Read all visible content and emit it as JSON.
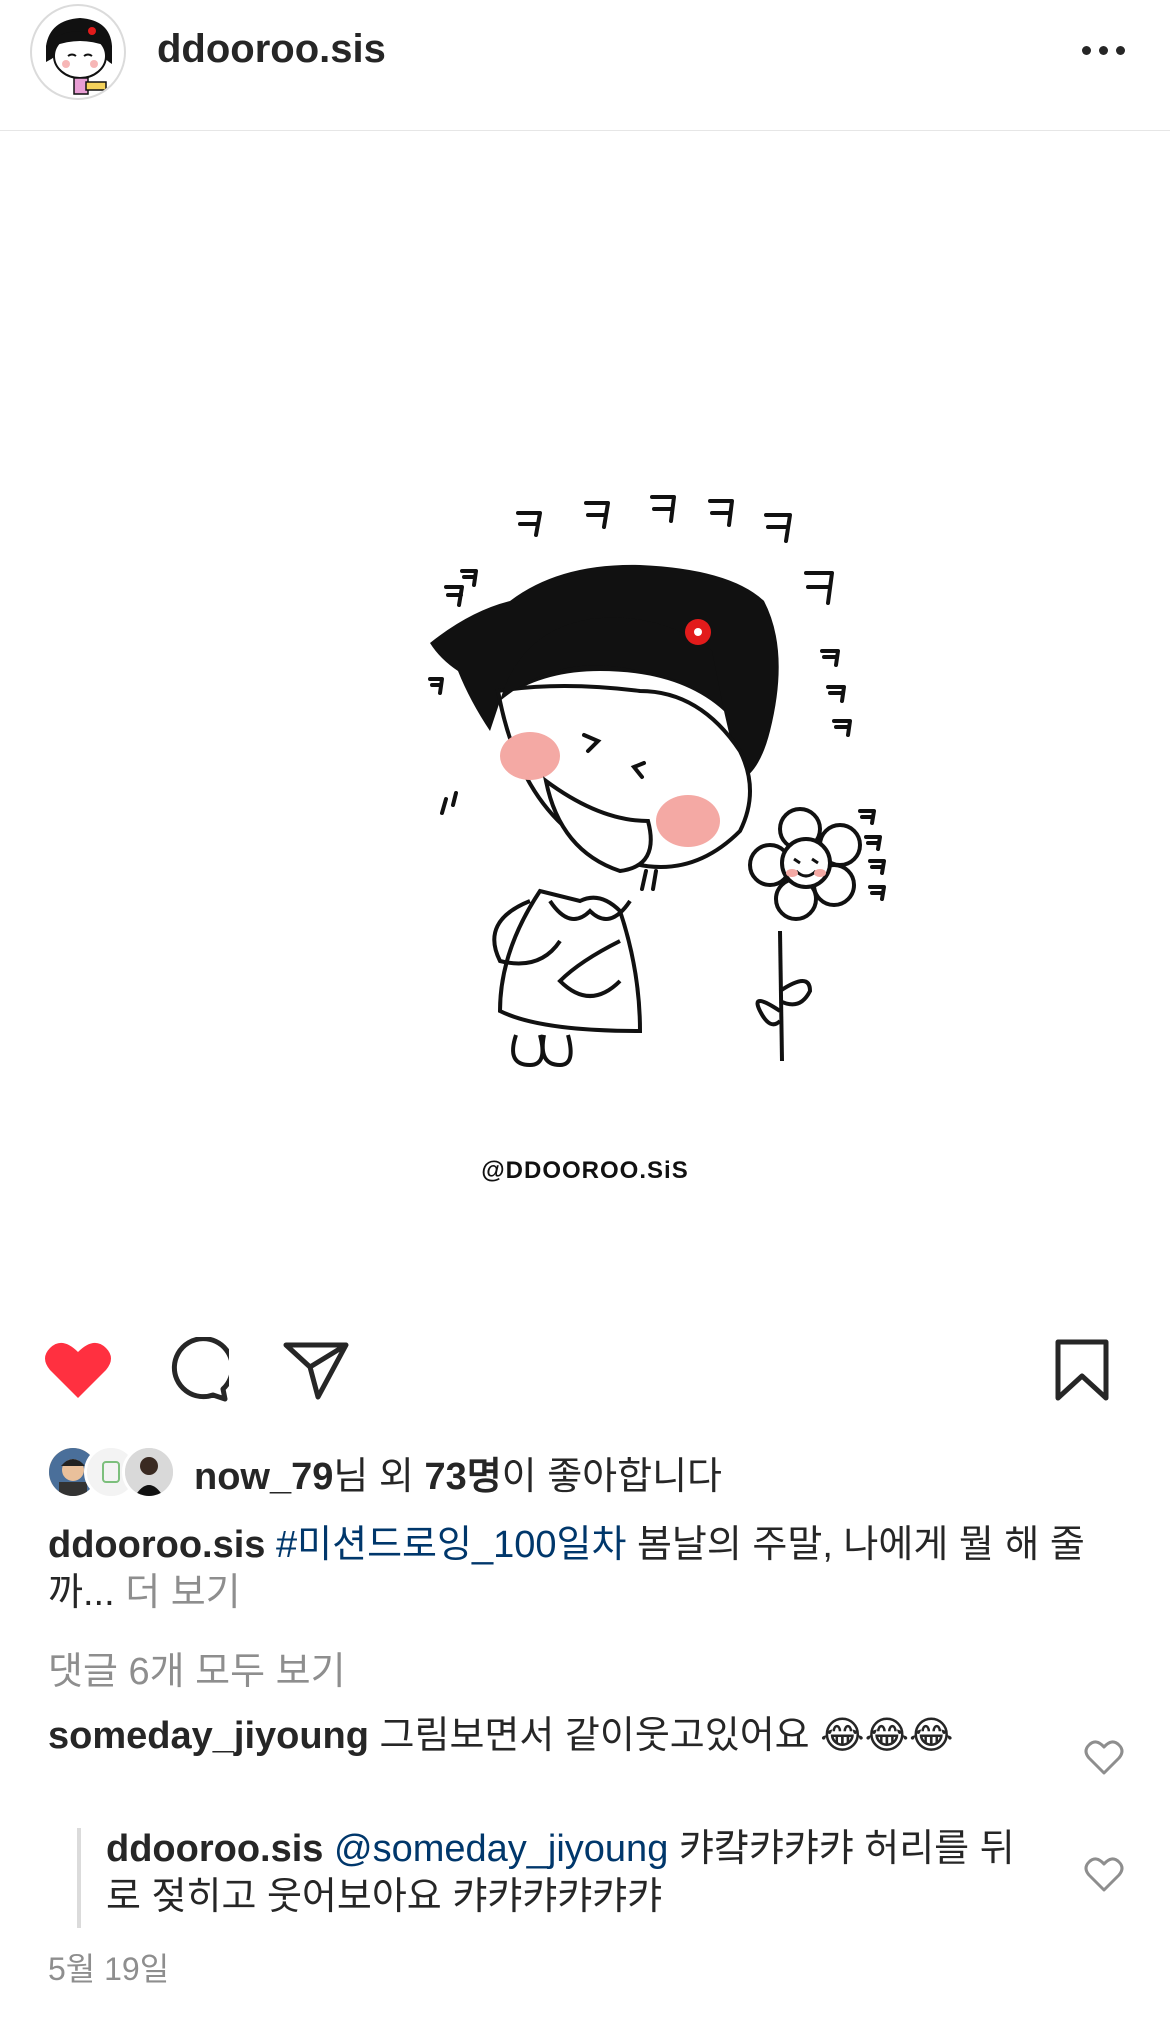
{
  "header": {
    "username": "ddooroo.sis",
    "more_icon": "more-horizontal-icon"
  },
  "post": {
    "watermark": "@DDOOROO.SiS",
    "illustration_text": [
      "ㅋ",
      "ㅋ",
      "ㅋ",
      "ㅋ",
      "ㅋ",
      "ㅋ"
    ]
  },
  "actions": {
    "like_icon": "heart-filled-icon",
    "like_color": "#ff3040",
    "comment_icon": "comment-icon",
    "share_icon": "send-icon",
    "save_icon": "bookmark-icon"
  },
  "likes": {
    "user": "now_79",
    "middle": "님 외 ",
    "count": "73명",
    "suffix": "이 좋아합니다"
  },
  "caption": {
    "username": "ddooroo.sis",
    "hashtag": "#미션드로잉_100일차",
    "text": " 봄날의 주말, 나에게 뭘 해 줄까...",
    "more": " 더 보기"
  },
  "view_all_comments": "댓글 6개 모두 보기",
  "comments": [
    {
      "username": "someday_jiyoung",
      "text": " 그림보면서 같이웃고있어요 😂😂😂"
    }
  ],
  "reply": {
    "username": "ddooroo.sis",
    "mention": " @someday_jiyoung",
    "text": " 캬컄캬캬캬 허리를 뒤로 젖히고 웃어보아요 캬캬캬캬캬캬"
  },
  "date": "5월 19일"
}
